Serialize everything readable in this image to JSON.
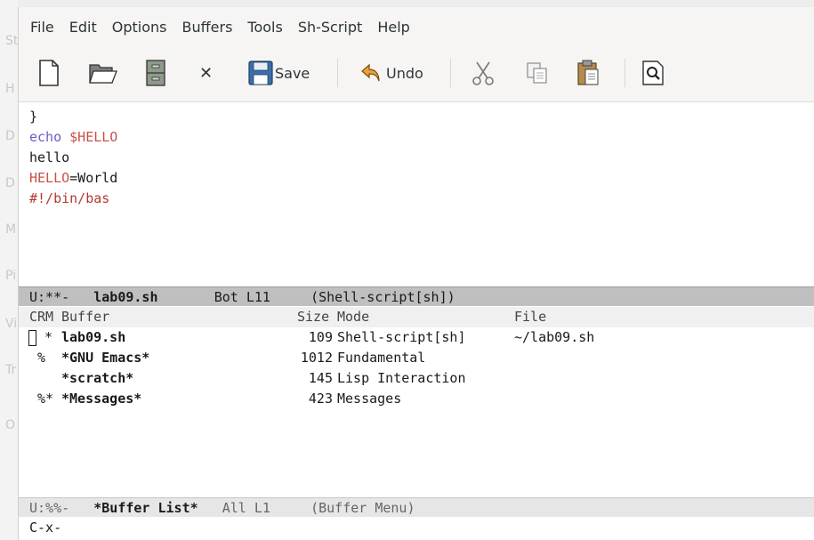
{
  "menubar": {
    "items": [
      "File",
      "Edit",
      "Options",
      "Buffers",
      "Tools",
      "Sh-Script",
      "Help"
    ]
  },
  "toolbar": {
    "save_label": "Save",
    "undo_label": "Undo",
    "close_glyph": "✕"
  },
  "editor": {
    "lines": [
      {
        "parts": [
          {
            "text": "}",
            "style": "plain"
          }
        ]
      },
      {
        "parts": [
          {
            "text": "echo ",
            "style": "kw"
          },
          {
            "text": "$HELLO",
            "style": "var"
          }
        ]
      },
      {
        "parts": [
          {
            "text": "hello",
            "style": "plain"
          }
        ]
      },
      {
        "parts": [
          {
            "text": "HELLO",
            "style": "var"
          },
          {
            "text": "=World",
            "style": "plain"
          }
        ]
      },
      {
        "parts": [
          {
            "text": "#!/bin/bas",
            "style": "comment"
          }
        ]
      }
    ]
  },
  "modeline_top": {
    "status": "U:**-",
    "buffer": "lab09.sh",
    "position": "Bot L11",
    "mode": "(Shell-script[sh])"
  },
  "buffer_list": {
    "headers": {
      "crm": "CRM",
      "buffer": "Buffer",
      "size": "Size",
      "mode": "Mode",
      "file": "File"
    },
    "rows": [
      {
        "flags": " *",
        "name": "lab09.sh",
        "size": "109",
        "mode": "Shell-script[sh]",
        "file": "~/lab09.sh",
        "current": true
      },
      {
        "flags": "%",
        "name": "*GNU Emacs*",
        "size": "1012",
        "mode": "Fundamental",
        "file": "",
        "current": false
      },
      {
        "flags": "",
        "name": "*scratch*",
        "size": "145",
        "mode": "Lisp Interaction",
        "file": "",
        "current": false
      },
      {
        "flags": "%*",
        "name": "*Messages*",
        "size": "423",
        "mode": "Messages",
        "file": "",
        "current": false
      }
    ]
  },
  "modeline_bottom": {
    "status": "U:%%-",
    "buffer": "*Buffer List*",
    "position": "All L1",
    "mode": "(Buffer Menu)"
  },
  "minibuffer": {
    "text": "C-x-"
  },
  "background": {
    "letters": [
      "St",
      "H",
      "D",
      "D",
      "M",
      "Pi",
      "Vi",
      "Tr",
      "O"
    ]
  }
}
